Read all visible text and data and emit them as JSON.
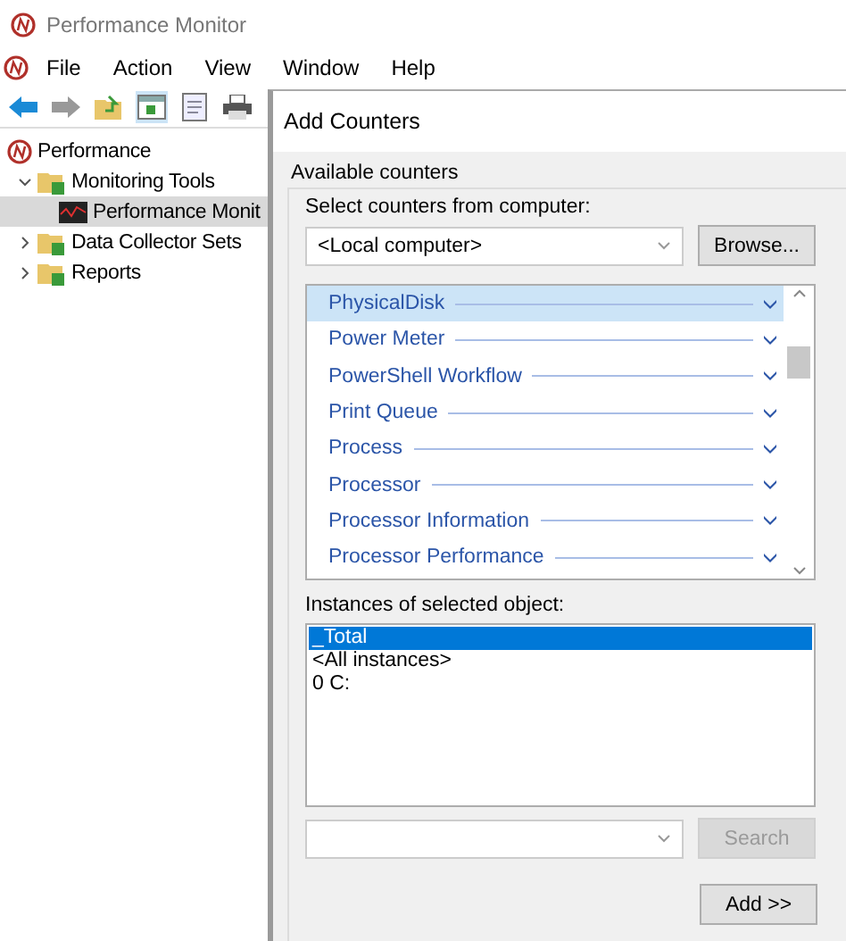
{
  "window": {
    "title": "Performance Monitor"
  },
  "menu": [
    "File",
    "Action",
    "View",
    "Window",
    "Help"
  ],
  "tree": [
    {
      "label": "Performance",
      "kind": "root",
      "children": [
        {
          "label": "Monitoring Tools",
          "kind": "folder",
          "expanded": true,
          "children": [
            {
              "label": "Performance Monit",
              "kind": "monitor",
              "selected": true
            }
          ]
        },
        {
          "label": "Data Collector Sets",
          "kind": "folder",
          "expanded": false
        },
        {
          "label": "Reports",
          "kind": "folder",
          "expanded": false
        }
      ]
    }
  ],
  "dialog": {
    "title": "Add Counters",
    "group_label": "Available counters",
    "computer_label": "Select counters from computer:",
    "computer_value": "<Local computer>",
    "browse_button": "Browse...",
    "counters": [
      {
        "label": "PhysicalDisk",
        "selected": true
      },
      {
        "label": "Power Meter",
        "selected": false
      },
      {
        "label": "PowerShell Workflow",
        "selected": false
      },
      {
        "label": "Print Queue",
        "selected": false
      },
      {
        "label": "Process",
        "selected": false
      },
      {
        "label": "Processor",
        "selected": false
      },
      {
        "label": "Processor Information",
        "selected": false
      },
      {
        "label": "Processor Performance",
        "selected": false
      }
    ],
    "instances_label": "Instances of selected object:",
    "instances": [
      {
        "label": "_Total",
        "selected": true
      },
      {
        "label": "<All instances>",
        "selected": false
      },
      {
        "label": "0 C:",
        "selected": false
      }
    ],
    "search_button": {
      "label": "Search",
      "disabled": true
    },
    "add_button": "Add >>"
  }
}
